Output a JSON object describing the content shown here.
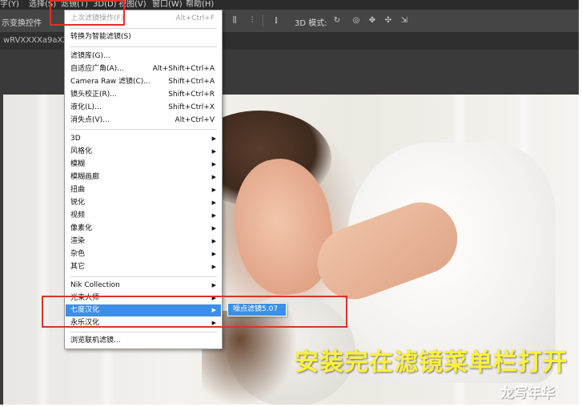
{
  "menubar": {
    "items": [
      "字(Y)",
      "选择(S)",
      "滤镜(T)",
      "3D(D)",
      "视图(V)",
      "窗口(W)",
      "帮助(H)"
    ]
  },
  "options_bar": {
    "left_label": "示变换控件",
    "mode_label": "3D 模式:",
    "icons": [
      "align-icon",
      "distribute-icon",
      "3d-rotate-icon",
      "3d-roll-icon",
      "3d-drag-icon",
      "3d-slide-icon",
      "3d-scale-icon"
    ]
  },
  "document_tab": {
    "title": "wRVXXXXa9aXX"
  },
  "filter_menu": {
    "last_filter": {
      "label": "上次滤镜操作(F)",
      "shortcut": "Alt+Ctrl+F",
      "disabled": true
    },
    "convert_smart": {
      "label": "转换为智能滤镜(S)"
    },
    "group1": [
      {
        "label": "滤镜库(G)...",
        "shortcut": ""
      },
      {
        "label": "自适应广角(A)...",
        "shortcut": "Alt+Shift+Ctrl+A"
      },
      {
        "label": "Camera Raw 滤镜(C)...",
        "shortcut": "Shift+Ctrl+A"
      },
      {
        "label": "镜头校正(R)...",
        "shortcut": "Shift+Ctrl+R"
      },
      {
        "label": "液化(L)...",
        "shortcut": "Shift+Ctrl+X"
      },
      {
        "label": "消失点(V)...",
        "shortcut": "Alt+Ctrl+V"
      }
    ],
    "group2": [
      "3D",
      "风格化",
      "模糊",
      "模糊画廊",
      "扭曲",
      "锐化",
      "视频",
      "像素化",
      "渲染",
      "杂色",
      "其它"
    ],
    "group3": [
      "Nik Collection",
      "光束大师",
      "七度汉化",
      "永乐汉化"
    ],
    "highlighted": "七度汉化",
    "browse_online": "浏览联机滤镜..."
  },
  "submenu": {
    "item": "噪点滤镜5.07"
  },
  "colors": {
    "highlight": "#3d8ee6",
    "annotation_red": "#e0302a",
    "caption_yellow": "#fff23a"
  },
  "caption": "安装完在滤镜菜单栏打开",
  "watermark": "龙写年华"
}
